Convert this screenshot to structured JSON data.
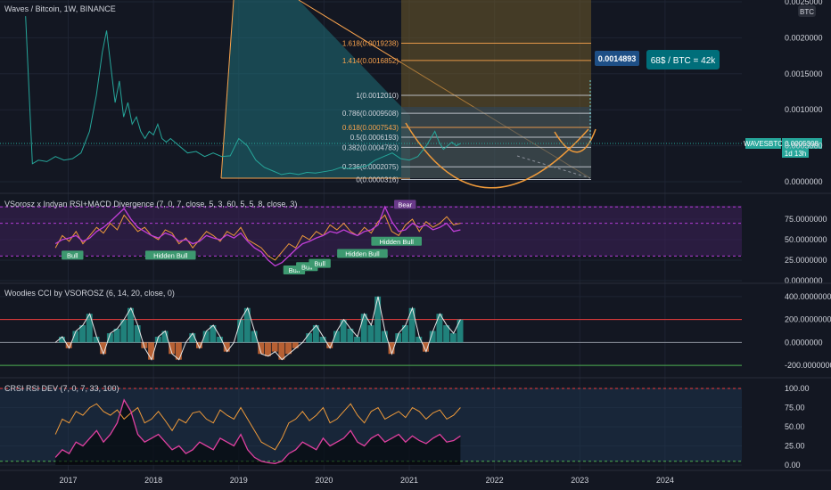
{
  "header": {
    "title": "Waves / Bitcoin, 1W, BINANCE",
    "currency_badge": "BTC"
  },
  "colors": {
    "background": "#131722",
    "grid": "#1e2433",
    "text": "#d1d4dc",
    "price_line": "#26a69a",
    "fib_orange": "#f7a24d",
    "teal_fill": "#1f6f78",
    "purple": "#b43bd6",
    "orange_line": "#ef9a3a",
    "green_label": "#3d9970",
    "red_line": "#ef3b3b",
    "green_line": "#4caf50",
    "pink": "#e040a0",
    "target_box": "#006e7a"
  },
  "chart_data": [
    {
      "type": "line",
      "name": "price",
      "title": "Waves / Bitcoin, 1W, BINANCE",
      "scale": "linear",
      "ylim": [
        0,
        0.0025
      ],
      "y_ticks": [
        "0.0000000",
        "0.0005000",
        "0.0010000",
        "0.0015000",
        "0.0020000",
        "0.0025000"
      ],
      "x_ticks": [
        "2017",
        "2018",
        "2019",
        "2020",
        "2021",
        "2022",
        "2023",
        "2024"
      ],
      "xlim": [
        2016.2,
        2024.9
      ],
      "series": [
        {
          "name": "WAVESBTC",
          "x": [
            2016.5,
            2016.58,
            2016.65,
            2016.75,
            2016.85,
            2016.95,
            2017.05,
            2017.15,
            2017.25,
            2017.33,
            2017.4,
            2017.45,
            2017.5,
            2017.55,
            2017.6,
            2017.65,
            2017.7,
            2017.75,
            2017.8,
            2017.85,
            2017.9,
            2017.95,
            2018.0,
            2018.05,
            2018.1,
            2018.15,
            2018.2,
            2018.3,
            2018.4,
            2018.5,
            2018.6,
            2018.7,
            2018.8,
            2018.9,
            2019.0,
            2019.05,
            2019.1,
            2019.2,
            2019.3,
            2019.4,
            2019.5,
            2019.6,
            2019.7,
            2019.8,
            2019.9,
            2020.0,
            2020.1,
            2020.2,
            2020.3,
            2020.4,
            2020.5,
            2020.6,
            2020.7,
            2020.8,
            2020.9,
            2021.0,
            2021.1,
            2021.2,
            2021.25,
            2021.3,
            2021.35,
            2021.4,
            2021.45,
            2021.5,
            2021.55,
            2021.6
          ],
          "values": [
            0.0023,
            0.00025,
            0.0003,
            0.00028,
            0.00035,
            0.0003,
            0.00032,
            0.0004,
            0.0007,
            0.0012,
            0.0018,
            0.0021,
            0.0016,
            0.0011,
            0.0014,
            0.0009,
            0.0011,
            0.0008,
            0.0009,
            0.0007,
            0.0006,
            0.0007,
            0.00065,
            0.0008,
            0.0006,
            0.00055,
            0.0006,
            0.0005,
            0.0004,
            0.00042,
            0.00035,
            0.0004,
            0.00035,
            0.00036,
            0.0006,
            0.00055,
            0.0005,
            0.0003,
            0.0002,
            0.00015,
            0.0001,
            0.00012,
            0.0001,
            0.00013,
            0.00012,
            0.00014,
            0.00016,
            0.0002,
            0.00018,
            0.0002,
            0.00022,
            0.0003,
            0.00035,
            0.0004,
            0.00032,
            0.0003,
            0.00035,
            0.0005,
            0.0006,
            0.0007,
            0.00055,
            0.00045,
            0.0005,
            0.00055,
            0.0005,
            0.0005308
          ]
        }
      ],
      "fib_levels": [
        {
          "ratio": "0",
          "label": "0(0.0000316)",
          "value": 3.16e-05
        },
        {
          "ratio": "0.236",
          "label": "0.236(0.0002075)",
          "value": 0.0002075
        },
        {
          "ratio": "0.382",
          "label": "0.382(0.0004783)",
          "value": 0.0004783
        },
        {
          "ratio": "0.5",
          "label": "0.5(0.0006193)",
          "value": 0.0006193
        },
        {
          "ratio": "0.618",
          "label": "0.618(0.0007543)",
          "value": 0.0007543
        },
        {
          "ratio": "0.786",
          "label": "0.786(0.0009508)",
          "value": 0.0009508
        },
        {
          "ratio": "1",
          "label": "1(0.0012010)",
          "value": 0.001201
        },
        {
          "ratio": "1.414",
          "label": "1.414(0.0016852)",
          "value": 0.0016852
        },
        {
          "ratio": "1.618",
          "label": "1.618(0.0019238)",
          "value": 0.0019238
        }
      ],
      "annotations": {
        "target_price": "0.0014893",
        "target_note": "68$ / BTC = 42k",
        "last_symbol": "WAVESBTC",
        "last_price": "0.0005308",
        "countdown": "1d 13h"
      }
    },
    {
      "type": "line",
      "title": "VSorosz x Indyan RSI+MACD Divergence (7, 0, 7, close, 5, 3, 60, 5, 5, 8, close, 3)",
      "ylim": [
        0,
        100
      ],
      "y_ticks": [
        "0.0000000",
        "25.0000000",
        "50.0000000",
        "75.0000000"
      ],
      "bands": [
        30,
        70,
        90
      ],
      "series": [
        {
          "name": "",
          "values": [
            40,
            55,
            48,
            60,
            45,
            55,
            65,
            58,
            70,
            62,
            80,
            70,
            60,
            65,
            55,
            50,
            62,
            58,
            45,
            52,
            40,
            50,
            60,
            55,
            48,
            60,
            55,
            65,
            50,
            45,
            40,
            30,
            25,
            35,
            45,
            40,
            55,
            50,
            60,
            55,
            68,
            62,
            70,
            60,
            55,
            65,
            58,
            72,
            80,
            60,
            55,
            68,
            75,
            60,
            72,
            65,
            70,
            78,
            68,
            70
          ]
        },
        {
          "name": "",
          "values": [
            45,
            50,
            52,
            55,
            48,
            52,
            60,
            65,
            72,
            80,
            88,
            75,
            65,
            60,
            55,
            52,
            58,
            55,
            48,
            50,
            45,
            48,
            55,
            52,
            50,
            56,
            52,
            58,
            48,
            40,
            35,
            25,
            18,
            22,
            30,
            38,
            45,
            48,
            52,
            55,
            60,
            58,
            62,
            58,
            55,
            60,
            62,
            68,
            90,
            72,
            60,
            62,
            70,
            65,
            68,
            62,
            65,
            70,
            60,
            62
          ]
        }
      ],
      "labels": [
        {
          "text": "Bull",
          "x": 2017.05,
          "y": 30
        },
        {
          "text": "Hidden Bull",
          "x": 2018.2,
          "y": 30
        },
        {
          "text": "Bull",
          "x": 2019.65,
          "y": 12
        },
        {
          "text": "Bull",
          "x": 2019.8,
          "y": 16
        },
        {
          "text": "Bull",
          "x": 2019.95,
          "y": 20
        },
        {
          "text": "Hidden Bull",
          "x": 2020.45,
          "y": 32
        },
        {
          "text": "Hidden Bull",
          "x": 2020.85,
          "y": 47
        },
        {
          "text": "Bear",
          "x": 2020.95,
          "y": 92
        }
      ]
    },
    {
      "type": "line",
      "title": "Woodies CCI by VSOROSZ (6, 14, 20, close, 0)",
      "ylim": [
        -300,
        500
      ],
      "y_ticks": [
        "-200.0000000",
        "0.0000000",
        "200.0000000",
        "400.0000000"
      ],
      "levels": [
        -200,
        0,
        200
      ],
      "series": [
        {
          "name": "",
          "values": [
            0,
            50,
            -50,
            100,
            150,
            250,
            50,
            -100,
            80,
            120,
            200,
            300,
            150,
            -50,
            -150,
            50,
            100,
            -100,
            -150,
            0,
            80,
            -50,
            100,
            150,
            50,
            -80,
            0,
            200,
            300,
            100,
            -100,
            -120,
            -80,
            -150,
            -100,
            -50,
            0,
            80,
            150,
            50,
            -50,
            100,
            200,
            120,
            50,
            250,
            150,
            400,
            100,
            -100,
            80,
            150,
            300,
            50,
            -80,
            100,
            250,
            150,
            80,
            200
          ]
        }
      ]
    },
    {
      "type": "line",
      "title": "CRSI RSI DEV (7, 0, 7, 33, 100)",
      "ylim": [
        0,
        100
      ],
      "y_ticks": [
        "0.00",
        "25.00",
        "50.00",
        "75.00",
        "100.00"
      ],
      "levels": [
        5,
        100
      ],
      "series": [
        {
          "name": "",
          "values": [
            40,
            60,
            55,
            70,
            65,
            75,
            80,
            70,
            65,
            72,
            60,
            68,
            75,
            55,
            60,
            70,
            58,
            45,
            60,
            55,
            68,
            70,
            60,
            55,
            72,
            65,
            60,
            75,
            60,
            45,
            30,
            25,
            20,
            35,
            55,
            60,
            70,
            58,
            65,
            75,
            55,
            60,
            70,
            80,
            65,
            55,
            70,
            75,
            60,
            65,
            70,
            62,
            75,
            70,
            60,
            68,
            72,
            60,
            65,
            75
          ]
        },
        {
          "name": "",
          "values": [
            10,
            20,
            15,
            30,
            25,
            35,
            45,
            30,
            40,
            55,
            85,
            70,
            40,
            30,
            35,
            40,
            30,
            20,
            25,
            15,
            20,
            30,
            25,
            20,
            35,
            30,
            25,
            40,
            20,
            10,
            5,
            3,
            2,
            5,
            15,
            20,
            30,
            25,
            20,
            35,
            25,
            30,
            35,
            45,
            30,
            25,
            35,
            40,
            30,
            35,
            40,
            30,
            38,
            32,
            28,
            35,
            40,
            30,
            32,
            38
          ]
        }
      ]
    }
  ]
}
